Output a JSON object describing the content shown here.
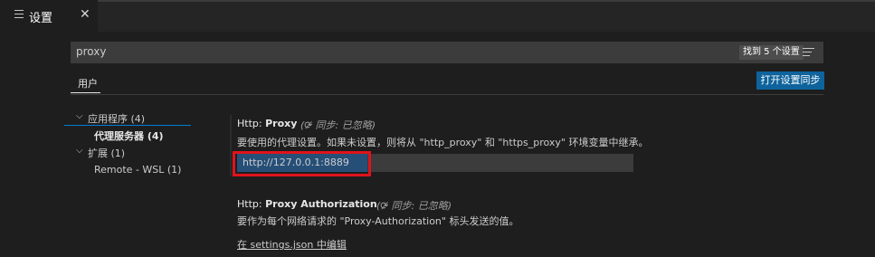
{
  "tab": {
    "title": "设置",
    "close": "✕"
  },
  "search": {
    "value": "proxy",
    "result_count": "找到 5 个设置"
  },
  "scopes": {
    "user_label": "用户",
    "sync_button": "打开设置同步"
  },
  "toc": {
    "items": [
      {
        "chevron": "⌵",
        "label": "应用程序 (4)"
      },
      {
        "label": "代理服务器 (4)"
      },
      {
        "chevron": "⌵",
        "label": "扩展 (1)"
      },
      {
        "label": "Remote - WSL (1)"
      }
    ]
  },
  "settings": {
    "proxy": {
      "category": "Http: ",
      "key": "Proxy",
      "sync_ignored": "同步: 已忽略)",
      "sync_prefix": "(",
      "description": "要使用的代理设置。如果未设置，则将从 \"http_proxy\" 和 \"https_proxy\" 环境变量中继承。",
      "value": "http://127.0.0.1:8889"
    },
    "proxy_authorization": {
      "category": "Http: ",
      "key": "Proxy Authorization",
      "sync_prefix": "(",
      "sync_ignored": "同步: 已忽略)",
      "description": "要作为每个网络请求的 \"Proxy-Authorization\" 标头发送的值。",
      "edit_link": "在 settings.json 中编辑"
    }
  },
  "icons": {
    "tab": "menu-lines-icon",
    "filter": "filter-icon",
    "sync_ignored": "sync-ignored-icon",
    "chevron": "chevron-down-icon"
  },
  "colors": {
    "accent": "#0e639c",
    "highlight": "#e0131b",
    "selection": "#264f78"
  }
}
